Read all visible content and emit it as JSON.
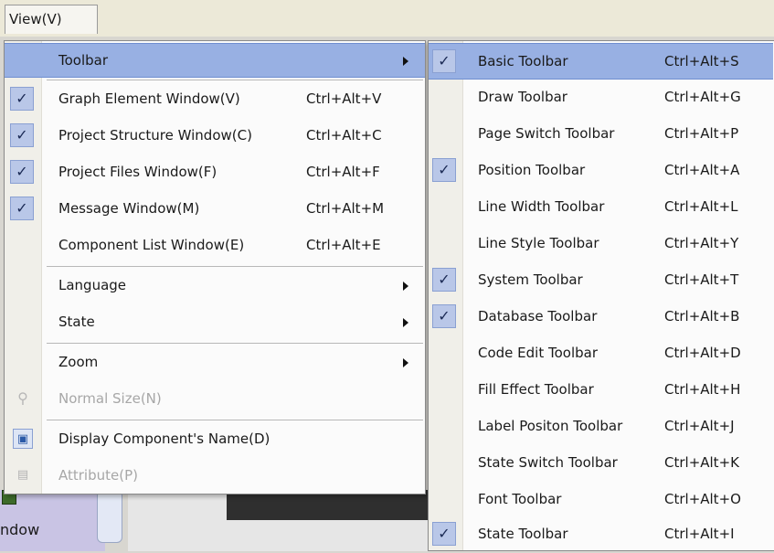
{
  "menubar": {
    "view_label": "View(V)"
  },
  "background": {
    "window_label": "ndow"
  },
  "main_menu": {
    "items": [
      {
        "label": "Toolbar",
        "shortcut": "",
        "submenu": true,
        "checked": false,
        "highlight": true
      },
      {
        "label": "Graph Element Window(V)",
        "shortcut": "Ctrl+Alt+V",
        "checked": true
      },
      {
        "label": "Project Structure Window(C)",
        "shortcut": "Ctrl+Alt+C",
        "checked": true
      },
      {
        "label": "Project Files Window(F)",
        "shortcut": "Ctrl+Alt+F",
        "checked": true
      },
      {
        "label": "Message Window(M)",
        "shortcut": "Ctrl+Alt+M",
        "checked": true
      },
      {
        "label": "Component List Window(E)",
        "shortcut": "Ctrl+Alt+E",
        "checked": false
      },
      {
        "label": "Language",
        "submenu": true
      },
      {
        "label": "State",
        "submenu": true
      },
      {
        "label": "Zoom",
        "submenu": true
      },
      {
        "label": "Normal Size(N)",
        "disabled": true,
        "icon": "magnifier-icon"
      },
      {
        "label": "Display Component's Name(D)",
        "icon": "display-name-icon"
      },
      {
        "label": "Attribute(P)",
        "disabled": true,
        "icon": "attribute-icon"
      }
    ]
  },
  "toolbar_submenu": {
    "items": [
      {
        "label": "Basic Toolbar",
        "shortcut": "Ctrl+Alt+S",
        "checked": true,
        "highlight": true
      },
      {
        "label": "Draw Toolbar",
        "shortcut": "Ctrl+Alt+G",
        "checked": false
      },
      {
        "label": "Page Switch Toolbar",
        "shortcut": "Ctrl+Alt+P",
        "checked": false
      },
      {
        "label": "Position Toolbar",
        "shortcut": "Ctrl+Alt+A",
        "checked": true
      },
      {
        "label": "Line Width Toolbar",
        "shortcut": "Ctrl+Alt+L",
        "checked": false
      },
      {
        "label": "Line Style Toolbar",
        "shortcut": "Ctrl+Alt+Y",
        "checked": false
      },
      {
        "label": "System Toolbar",
        "shortcut": "Ctrl+Alt+T",
        "checked": true
      },
      {
        "label": "Database Toolbar",
        "shortcut": "Ctrl+Alt+B",
        "checked": true
      },
      {
        "label": "Code Edit Toolbar",
        "shortcut": "Ctrl+Alt+D",
        "checked": false
      },
      {
        "label": "Fill Effect Toolbar",
        "shortcut": "Ctrl+Alt+H",
        "checked": false
      },
      {
        "label": "Label Positon Toolbar",
        "shortcut": "Ctrl+Alt+J",
        "checked": false
      },
      {
        "label": "State Switch Toolbar",
        "shortcut": "Ctrl+Alt+K",
        "checked": false
      },
      {
        "label": "Font Toolbar",
        "shortcut": "Ctrl+Alt+O",
        "checked": false
      },
      {
        "label": "State Toolbar",
        "shortcut": "Ctrl+Alt+I",
        "checked": true
      }
    ]
  },
  "colors": {
    "highlight": "#98b0e3",
    "check_bg": "#b9c7e8",
    "disabled_text": "#a7a7a7"
  }
}
